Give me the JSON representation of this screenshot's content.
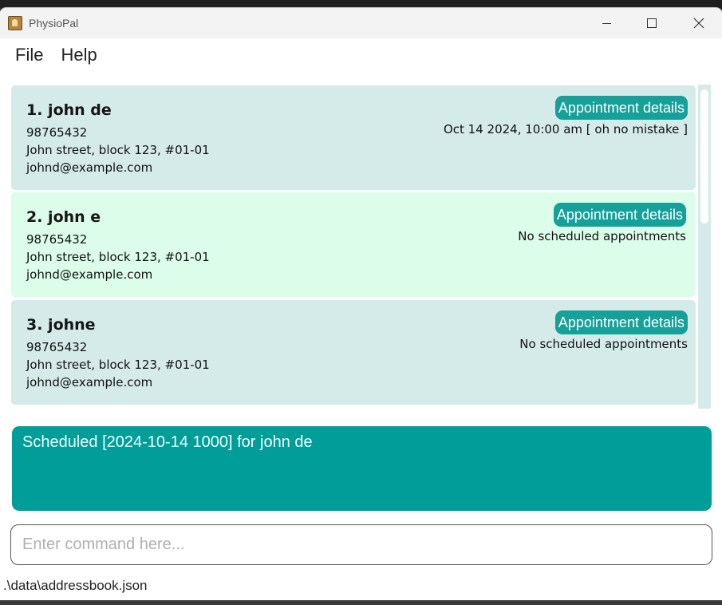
{
  "window": {
    "title": "PhysioPal"
  },
  "menu": {
    "file": "File",
    "help": "Help"
  },
  "persons": [
    {
      "name": "1. john de",
      "phone": "98765432",
      "address": "John street, block 123, #01-01",
      "email": "johnd@example.com",
      "appointment_button": "Appointment details",
      "appointment_text": "Oct 14 2024, 10:00 am [ oh no mistake ]"
    },
    {
      "name": "2. john e",
      "phone": "98765432",
      "address": "John street, block 123, #01-01",
      "email": "johnd@example.com",
      "appointment_button": "Appointment details",
      "appointment_text": "No scheduled appointments"
    },
    {
      "name": "3. johne",
      "phone": "98765432",
      "address": "John street, block 123, #01-01",
      "email": "johnd@example.com",
      "appointment_button": "Appointment details",
      "appointment_text": "No scheduled appointments"
    }
  ],
  "result": {
    "message": "Scheduled [2024-10-14 1000] for john de"
  },
  "command": {
    "placeholder": "Enter command here...",
    "value": ""
  },
  "status": {
    "file_path": ".\\data\\addressbook.json"
  },
  "colors": {
    "card_alt": "#d4ebe9",
    "card_selected": "#dcfde9",
    "accent": "#15a09a",
    "result_bg": "#009d99"
  },
  "icons": {
    "app": "address-book-icon",
    "minimize": "minimize-icon",
    "maximize": "maximize-icon",
    "close": "close-icon"
  }
}
